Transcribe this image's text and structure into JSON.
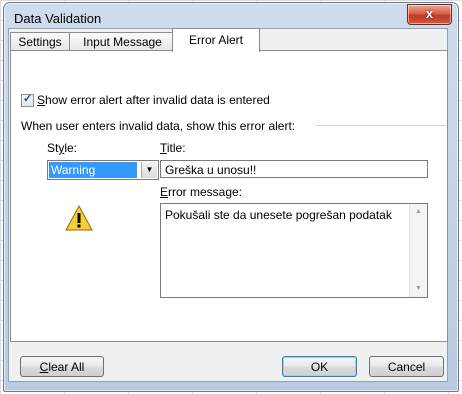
{
  "window": {
    "title": "Data Validation"
  },
  "tabs": [
    {
      "label": "Settings"
    },
    {
      "label": "Input Message"
    },
    {
      "label": "Error Alert"
    }
  ],
  "active_tab": "Error Alert",
  "show_alert": {
    "checked": true,
    "label_accel": "S",
    "label_rest": "how error alert after invalid data is entered"
  },
  "section_heading": "When user enters invalid data, show this error alert:",
  "style": {
    "label_accel": "y",
    "label_pre": "St",
    "label_post": "le:",
    "value": "Warning"
  },
  "title_field": {
    "label_accel": "T",
    "label_rest": "itle:",
    "value": "Greška u unosu!!"
  },
  "message_field": {
    "label_accel": "E",
    "label_rest": "rror message:",
    "value": "Pokušali ste da unesete pogrešan podatak"
  },
  "buttons": {
    "clear_all_accel": "C",
    "clear_all_rest": "lear All",
    "ok": "OK",
    "cancel": "Cancel",
    "close": "x"
  },
  "colors": {
    "selection": "#3399ff",
    "warning_fill": "#f5d033",
    "close_button": "#c8452f"
  },
  "icons": {
    "style_icon": "warning-triangle-icon"
  }
}
